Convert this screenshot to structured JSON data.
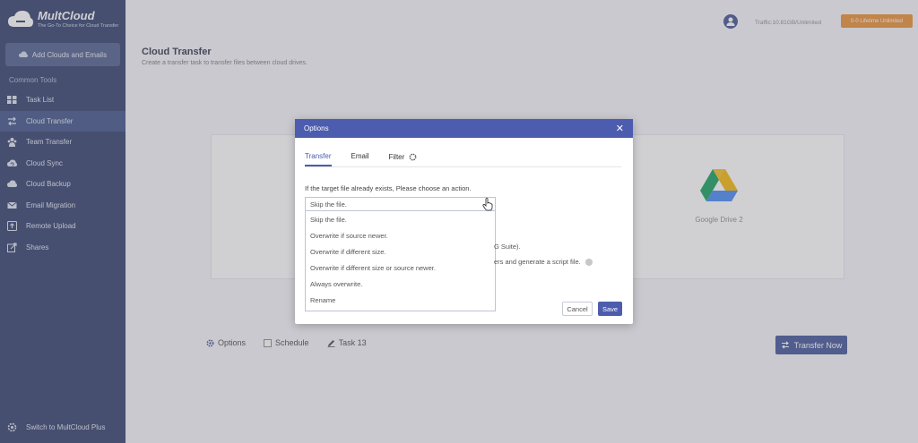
{
  "app": {
    "logo_name": "MultCloud",
    "logo_tagline": "The Go-To Choice for Cloud Transfer",
    "add_clouds_label": "Add Clouds and Emails",
    "section_title": "Common Tools",
    "bottom_link": "Switch to MultCloud Plus"
  },
  "sidebar": {
    "items": [
      {
        "label": "Task List",
        "icon": "grid-icon",
        "active": false
      },
      {
        "label": "Cloud Transfer",
        "icon": "transfer-arrows-icon",
        "active": true
      },
      {
        "label": "Team Transfer",
        "icon": "team-icon",
        "active": false
      },
      {
        "label": "Cloud Sync",
        "icon": "sync-icon",
        "active": false
      },
      {
        "label": "Cloud Backup",
        "icon": "backup-icon",
        "active": false
      },
      {
        "label": "Email Migration",
        "icon": "email-icon",
        "active": false
      },
      {
        "label": "Remote Upload",
        "icon": "upload-icon",
        "active": false
      },
      {
        "label": "Shares",
        "icon": "share-icon",
        "active": false
      }
    ]
  },
  "topbar": {
    "traffic": "Traffic:10.81GB/Unlimited",
    "upgrade_label": "0-0 Lifetime Unlimited"
  },
  "page": {
    "title": "Cloud Transfer",
    "subtitle": "Create a transfer task to transfer files between cloud drives.",
    "target_label": "Google Drive 2"
  },
  "bottom_bar": {
    "options_label": "Options",
    "schedule_label": "Schedule",
    "task_label": "Task 13",
    "transfer_now": "Transfer Now"
  },
  "dialog": {
    "title": "Options",
    "tabs": [
      "Transfer",
      "Email",
      "Filter"
    ],
    "active_tab": "Transfer",
    "prompt": "If the target file already exists, Please choose an action.",
    "selected": "Skip the file.",
    "options": [
      "Skip the file.",
      "Overwrite if source newer.",
      "Overwrite if different size.",
      "Overwrite if different size or source newer.",
      "Always overwrite.",
      "Rename"
    ],
    "behind_text_1": "G Suite).",
    "behind_text_2": "ers and generate a script file.",
    "cancel_label": "Cancel",
    "save_label": "Save"
  },
  "colors": {
    "sidebar": "#2b3a67",
    "accent": "#4c5cae",
    "upgrade": "#e98a2c"
  }
}
